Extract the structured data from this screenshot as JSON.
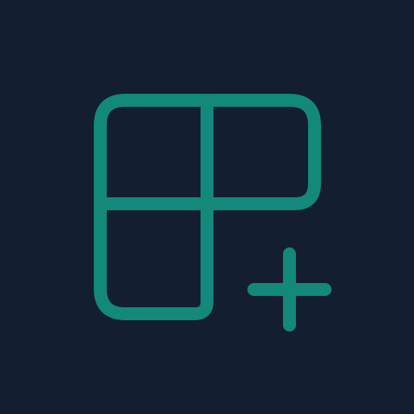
{
  "colors": {
    "background": "#141e31",
    "icon_stroke": "#12897b"
  },
  "icon": {
    "name": "layout-grid-add-icon"
  }
}
